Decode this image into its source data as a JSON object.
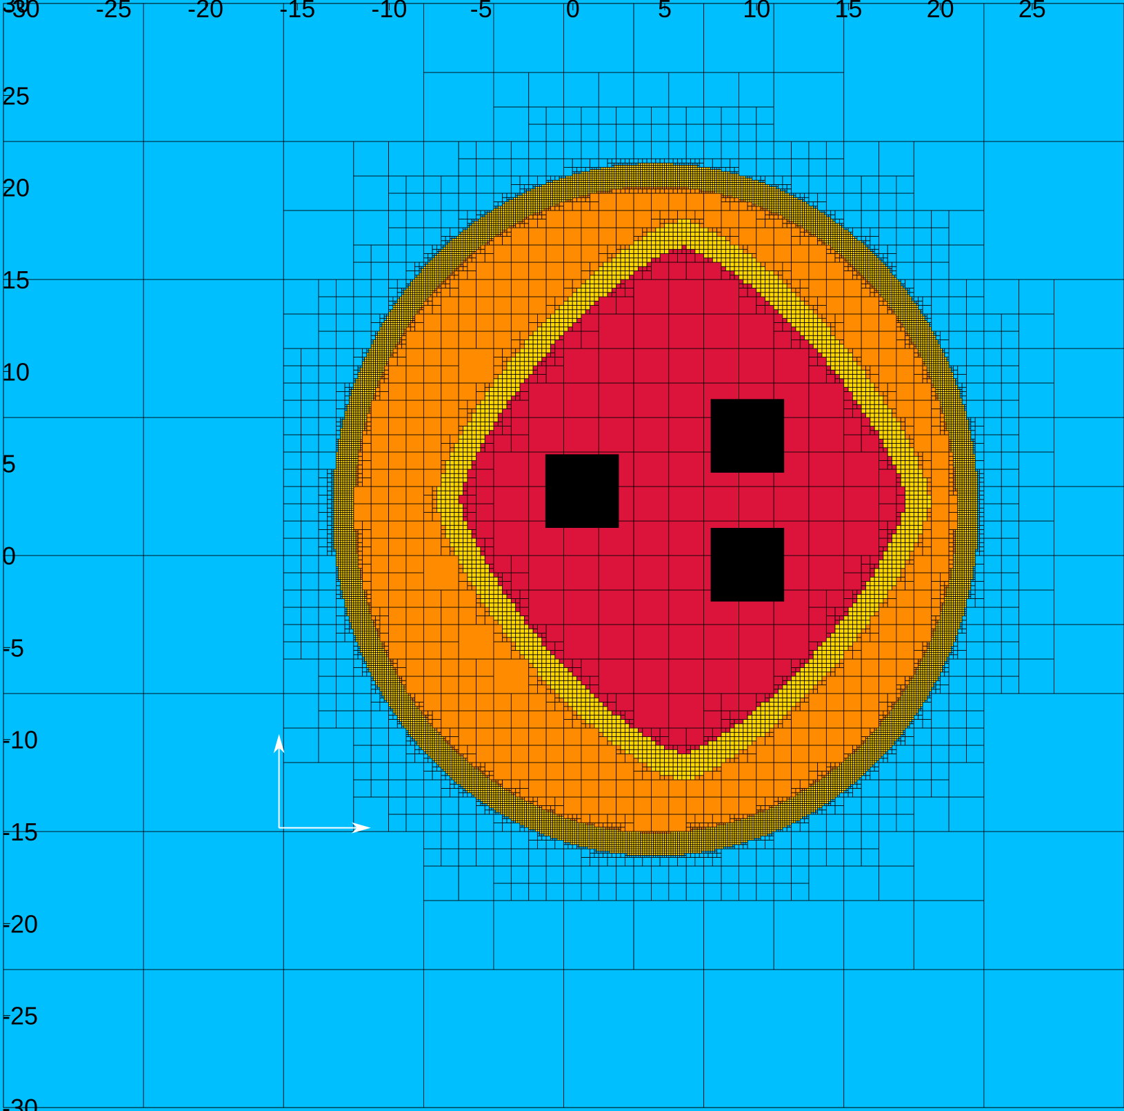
{
  "x_ticks": [
    {
      "v": -30,
      "label": "-30"
    },
    {
      "v": -25,
      "label": "-25"
    },
    {
      "v": -20,
      "label": "-20"
    },
    {
      "v": -15,
      "label": "-15"
    },
    {
      "v": -10,
      "label": "-10"
    },
    {
      "v": -5,
      "label": "-5"
    },
    {
      "v": 0,
      "label": "0"
    },
    {
      "v": 5,
      "label": "5"
    },
    {
      "v": 10,
      "label": "10"
    },
    {
      "v": 15,
      "label": "15"
    },
    {
      "v": 20,
      "label": "20"
    },
    {
      "v": 25,
      "label": "25"
    }
  ],
  "y_ticks": [
    {
      "v": 30,
      "label": "30"
    },
    {
      "v": 25,
      "label": "25"
    },
    {
      "v": 20,
      "label": "20"
    },
    {
      "v": 15,
      "label": "15"
    },
    {
      "v": 10,
      "label": "10"
    },
    {
      "v": 5,
      "label": "5"
    },
    {
      "v": 0,
      "label": "0"
    },
    {
      "v": -5,
      "label": "-5"
    },
    {
      "v": -10,
      "label": "-10"
    },
    {
      "v": -15,
      "label": "-15"
    },
    {
      "v": -20,
      "label": "-20"
    },
    {
      "v": -25,
      "label": "-25"
    },
    {
      "v": -30,
      "label": "-30"
    }
  ],
  "domain": {
    "xmin": -31,
    "xmax": 30,
    "ymin": -30,
    "ymax": 30
  },
  "colors": {
    "background": "#00bfff",
    "outer_ring": "#ff8c00",
    "front_band": "#ffd700",
    "core": "#dc143c",
    "obstacle": "#000000",
    "grid_line": "#000000",
    "axis_arrows": "#ffffff"
  },
  "regions": {
    "outer_ellipse": {
      "cx": 4.5,
      "cy": 2.5,
      "rx": 17.0,
      "ry": 18.2
    },
    "core_blob": {
      "cx": 6.0,
      "cy": 3.0,
      "rx": 12.8,
      "ry": 14.5
    }
  },
  "obstacles": [
    {
      "x0": -1.5,
      "x1": 2.5,
      "y0": 1.5,
      "y1": 5.5
    },
    {
      "x0": 7.5,
      "x1": 11.5,
      "y0": 4.5,
      "y1": 8.5
    },
    {
      "x0": 7.5,
      "x1": 11.5,
      "y0": -2.5,
      "y1": 1.5
    }
  ],
  "axis_arrows": {
    "origin": [
      -16,
      -14.8
    ],
    "x_tip": [
      -11,
      -14.8
    ],
    "y_tip": [
      -16,
      -9.7
    ]
  }
}
